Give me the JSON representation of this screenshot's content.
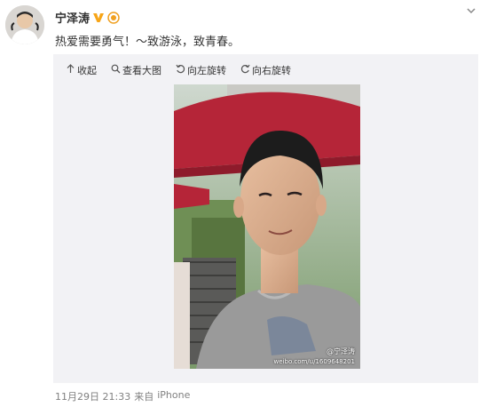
{
  "post": {
    "username": "宁泽涛",
    "text": "热爱需要勇气！～致游泳，致青春。",
    "timestamp": "11月29日 21:33",
    "source_prefix": "来自",
    "source": "iPhone"
  },
  "toolbar": {
    "collapse": "收起",
    "view_large": "查看大图",
    "rotate_left": "向左旋转",
    "rotate_right": "向右旋转"
  },
  "watermark": {
    "name": "@宁泽涛",
    "url": "weibo.com/u/1609648201"
  },
  "colors": {
    "vip_orange": "#f7a518",
    "link": "#333333",
    "muted": "#808080",
    "media_bg": "#f2f2f5"
  },
  "icons": [
    "avatar",
    "verified-v-icon",
    "honor-badge-icon",
    "chevron-down-icon",
    "collapse-arrow-icon",
    "search-icon",
    "rotate-left-icon",
    "rotate-right-icon"
  ]
}
